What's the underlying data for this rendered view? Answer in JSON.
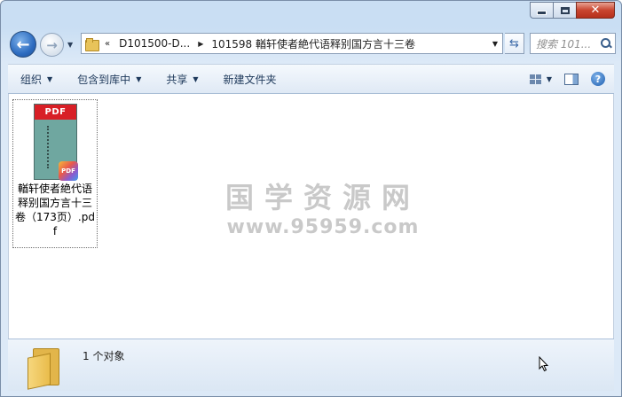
{
  "window": {
    "minimize_icon": "minimize-icon",
    "maximize_icon": "maximize-icon",
    "close_glyph": "✕"
  },
  "nav": {
    "back_glyph": "←",
    "forward_glyph": "→",
    "breadcrumb_overflow": "«",
    "breadcrumb": [
      "D101500-D...",
      "101598 輶轩使者絶代语释别国方言十三卷"
    ],
    "search_placeholder": "搜索 101..."
  },
  "toolbar": {
    "organize": "组织",
    "include_in_library": "包含到库中",
    "share": "共享",
    "new_folder": "新建文件夹"
  },
  "files": [
    {
      "name": "輶轩使者絶代语释别国方言十三卷（173页）.pdf",
      "thumb_label": "PDF",
      "badge_label": "PDF"
    }
  ],
  "watermark": {
    "text": "国学资源网",
    "url": "www.95959.com"
  },
  "status": {
    "count_text": "1 个对象"
  },
  "colors": {
    "accent": "#2d6cc0",
    "close_red": "#c9452f",
    "pdf_red": "#d81f26"
  }
}
